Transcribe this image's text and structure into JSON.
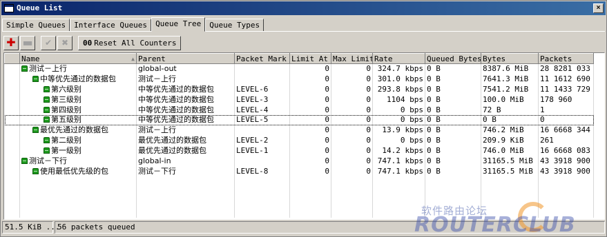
{
  "window": {
    "title": "Queue List",
    "close_label": "×"
  },
  "tabs": [
    {
      "label": "Simple Queues",
      "active": false
    },
    {
      "label": "Interface Queues",
      "active": false
    },
    {
      "label": "Queue Tree",
      "active": true
    },
    {
      "label": "Queue Types",
      "active": false
    }
  ],
  "toolbar": {
    "reset_label": "Reset All Counters",
    "reset_icon_text": "00"
  },
  "columns": [
    "Name",
    "Parent",
    "Packet Mark",
    "Limit At",
    "Max Limit",
    "Rate",
    "Queued Bytes",
    "Bytes",
    "Packets"
  ],
  "rows": [
    {
      "indent": 0,
      "name": "测试－上行",
      "parent": "global-out",
      "mark": "",
      "limit_at": "0",
      "max_limit": "0",
      "rate": "324.7 kbps",
      "queued": "0 B",
      "bytes": "8387.6 MiB",
      "packets": "28 8281 033"
    },
    {
      "indent": 1,
      "name": "中等优先通过的数据包",
      "parent": "测试－上行",
      "mark": "",
      "limit_at": "0",
      "max_limit": "0",
      "rate": "301.0 kbps",
      "queued": "0 B",
      "bytes": "7641.3 MiB",
      "packets": "11 1612 690"
    },
    {
      "indent": 2,
      "name": "第六级别",
      "parent": "中等优先通过的数据包",
      "mark": "LEVEL-6",
      "limit_at": "0",
      "max_limit": "0",
      "rate": "293.8 kbps",
      "queued": "0 B",
      "bytes": "7541.2 MiB",
      "packets": "11 1433 729"
    },
    {
      "indent": 2,
      "name": "第三级别",
      "parent": "中等优先通过的数据包",
      "mark": "LEVEL-3",
      "limit_at": "0",
      "max_limit": "0",
      "rate": "1104 bps",
      "queued": "0 B",
      "bytes": "100.0 MiB",
      "packets": "178 960"
    },
    {
      "indent": 2,
      "name": "第四级别",
      "parent": "中等优先通过的数据包",
      "mark": "LEVEL-4",
      "limit_at": "0",
      "max_limit": "0",
      "rate": "0 bps",
      "queued": "0 B",
      "bytes": "72 B",
      "packets": "1"
    },
    {
      "indent": 2,
      "name": "第五级别",
      "parent": "中等优先通过的数据包",
      "mark": "LEVEL-5",
      "limit_at": "0",
      "max_limit": "0",
      "rate": "0 bps",
      "queued": "0 B",
      "bytes": "0 B",
      "packets": "0",
      "selected": true
    },
    {
      "indent": 1,
      "name": "最优先通过的数据包",
      "parent": "测试－上行",
      "mark": "",
      "limit_at": "0",
      "max_limit": "0",
      "rate": "13.9 kbps",
      "queued": "0 B",
      "bytes": "746.2 MiB",
      "packets": "16 6668 344"
    },
    {
      "indent": 2,
      "name": "第二级别",
      "parent": "最优先通过的数据包",
      "mark": "LEVEL-2",
      "limit_at": "0",
      "max_limit": "0",
      "rate": "0 bps",
      "queued": "0 B",
      "bytes": "209.9 KiB",
      "packets": "261"
    },
    {
      "indent": 2,
      "name": "第一级别",
      "parent": "最优先通过的数据包",
      "mark": "LEVEL-1",
      "limit_at": "0",
      "max_limit": "0",
      "rate": "14.2 kbps",
      "queued": "0 B",
      "bytes": "746.0 MiB",
      "packets": "16 6668 083"
    },
    {
      "indent": 0,
      "name": "测试－下行",
      "parent": "global-in",
      "mark": "",
      "limit_at": "0",
      "max_limit": "0",
      "rate": "747.1 kbps",
      "queued": "0 B",
      "bytes": "31165.5 MiB",
      "packets": "43 3918 900"
    },
    {
      "indent": 1,
      "name": "使用最低优先级的包",
      "parent": "测试－下行",
      "mark": "LEVEL-8",
      "limit_at": "0",
      "max_limit": "0",
      "rate": "747.1 kbps",
      "queued": "0 B",
      "bytes": "31165.5 MiB",
      "packets": "43 3918 900"
    }
  ],
  "status": {
    "left": "51.5 KiB ...",
    "right": "56 packets queued"
  },
  "watermark": {
    "cn": "软件路由论坛",
    "en": "ROUTERCLUB"
  }
}
